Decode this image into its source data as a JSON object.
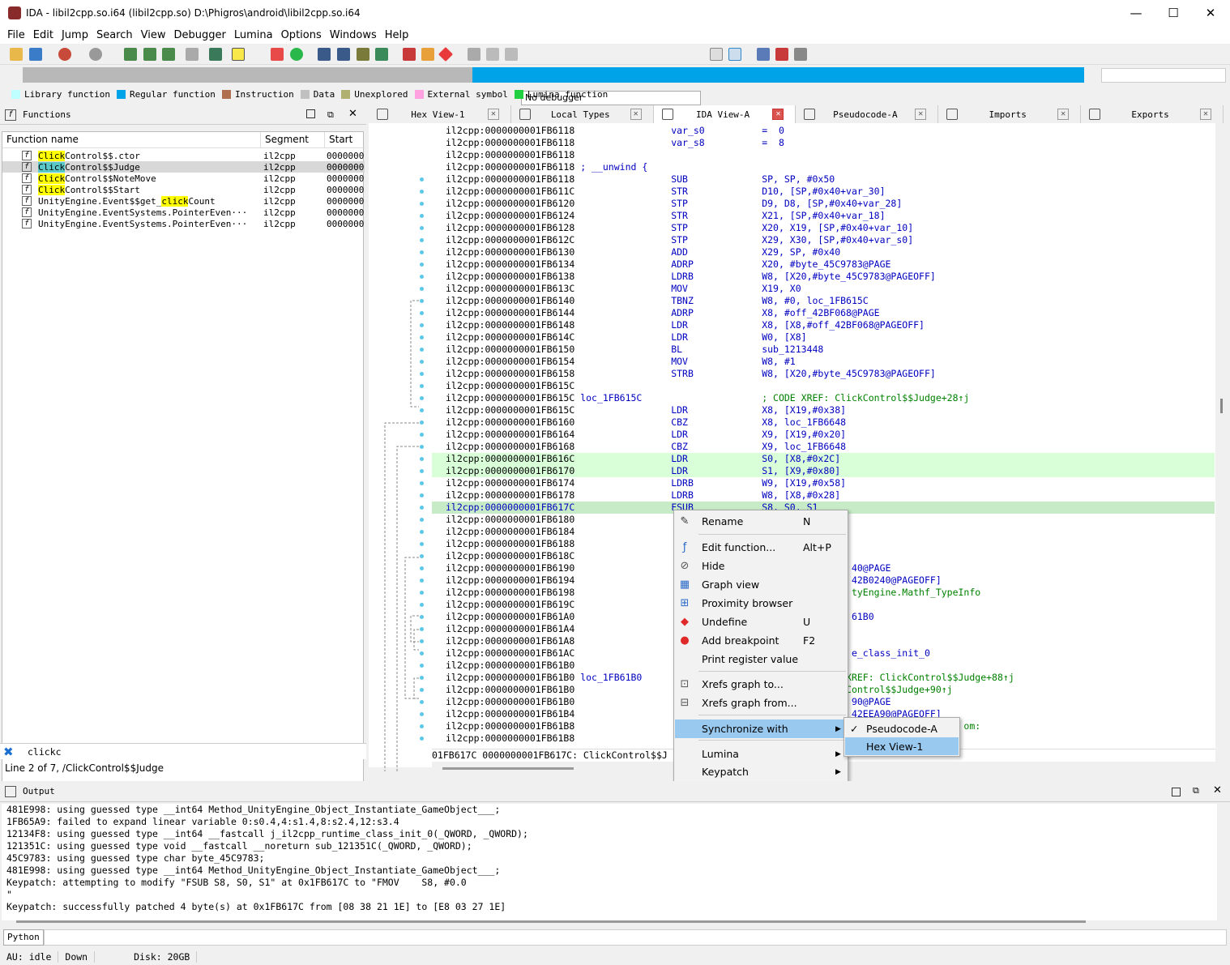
{
  "window": {
    "title": "IDA - libil2cpp.so.i64 (libil2cpp.so) D:\\Phigros\\android\\libil2cpp.so.i64",
    "minimize": "—",
    "maximize": "☐",
    "close": "✕"
  },
  "menu": [
    "File",
    "Edit",
    "Jump",
    "Search",
    "View",
    "Debugger",
    "Lumina",
    "Options",
    "Windows",
    "Help"
  ],
  "toolbar": {
    "debugger_select": "No debugger"
  },
  "legend": [
    {
      "label": "Library function",
      "color": "#c0ffff"
    },
    {
      "label": "Regular function",
      "color": "#00a2e8"
    },
    {
      "label": "Instruction",
      "color": "#b07050"
    },
    {
      "label": "Data",
      "color": "#c0c0c0"
    },
    {
      "label": "Unexplored",
      "color": "#b0b070"
    },
    {
      "label": "External symbol",
      "color": "#ffa0e0"
    },
    {
      "label": "Lumina function",
      "color": "#20d040"
    }
  ],
  "functions": {
    "title": "Functions",
    "columns": [
      "Function name",
      "Segment",
      "Start"
    ],
    "rows": [
      {
        "pre": "",
        "hl": "Click",
        "post": "Control$$.ctor",
        "seg": "il2cpp",
        "start": "0000000"
      },
      {
        "pre": "",
        "hl": "Click",
        "post": "Control$$Judge",
        "seg": "il2cpp",
        "start": "0000000"
      },
      {
        "pre": "",
        "hl": "Click",
        "post": "Control$$NoteMove",
        "seg": "il2cpp",
        "start": "0000000"
      },
      {
        "pre": "",
        "hl": "Click",
        "post": "Control$$Start",
        "seg": "il2cpp",
        "start": "0000000"
      },
      {
        "pre": "UnityEngine.Event$$get_",
        "hl": "click",
        "post": "Count",
        "seg": "il2cpp",
        "start": "0000000"
      },
      {
        "pre": "UnityEngine.EventSystems.PointerEven···",
        "hl": "",
        "post": "",
        "seg": "il2cpp",
        "start": "0000000"
      },
      {
        "pre": "UnityEngine.EventSystems.PointerEven···",
        "hl": "",
        "post": "",
        "seg": "il2cpp",
        "start": "0000000"
      }
    ],
    "filter": "clickc",
    "status": "Line 2 of 7, /ClickControl$$Judge"
  },
  "tabs": [
    {
      "label": "Hex View-1",
      "active": false
    },
    {
      "label": "Local Types",
      "active": false
    },
    {
      "label": "IDA View-A",
      "active": true
    },
    {
      "label": "Pseudocode-A",
      "active": false
    },
    {
      "label": "Imports",
      "active": false
    },
    {
      "label": "Exports",
      "active": false
    }
  ],
  "disasm": [
    {
      "addr": "il2cpp:0000000001FB6118",
      "l": "",
      "m": "var_s0",
      "o": "=  0",
      "c": ""
    },
    {
      "addr": "il2cpp:0000000001FB6118",
      "l": "",
      "m": "var_s8",
      "o": "=  8",
      "c": ""
    },
    {
      "addr": "il2cpp:0000000001FB6118",
      "l": "",
      "m": "",
      "o": "",
      "c": ""
    },
    {
      "addr": "il2cpp:0000000001FB6118",
      "l": "; __unwind {",
      "m": "",
      "o": "",
      "c": ""
    },
    {
      "addr": "il2cpp:0000000001FB6118",
      "l": "",
      "m": "SUB",
      "o": "SP, SP, #0x50",
      "c": ""
    },
    {
      "addr": "il2cpp:0000000001FB611C",
      "l": "",
      "m": "STR",
      "o": "D10, [SP,#0x40+var_30]",
      "c": ""
    },
    {
      "addr": "il2cpp:0000000001FB6120",
      "l": "",
      "m": "STP",
      "o": "D9, D8, [SP,#0x40+var_28]",
      "c": ""
    },
    {
      "addr": "il2cpp:0000000001FB6124",
      "l": "",
      "m": "STR",
      "o": "X21, [SP,#0x40+var_18]",
      "c": ""
    },
    {
      "addr": "il2cpp:0000000001FB6128",
      "l": "",
      "m": "STP",
      "o": "X20, X19, [SP,#0x40+var_10]",
      "c": ""
    },
    {
      "addr": "il2cpp:0000000001FB612C",
      "l": "",
      "m": "STP",
      "o": "X29, X30, [SP,#0x40+var_s0]",
      "c": ""
    },
    {
      "addr": "il2cpp:0000000001FB6130",
      "l": "",
      "m": "ADD",
      "o": "X29, SP, #0x40",
      "c": ""
    },
    {
      "addr": "il2cpp:0000000001FB6134",
      "l": "",
      "m": "ADRP",
      "o": "X20, #byte_45C9783@PAGE",
      "c": ""
    },
    {
      "addr": "il2cpp:0000000001FB6138",
      "l": "",
      "m": "LDRB",
      "o": "W8, [X20,#byte_45C9783@PAGEOFF]",
      "c": ""
    },
    {
      "addr": "il2cpp:0000000001FB613C",
      "l": "",
      "m": "MOV",
      "o": "X19, X0",
      "c": ""
    },
    {
      "addr": "il2cpp:0000000001FB6140",
      "l": "",
      "m": "TBNZ",
      "o": "W8, #0, loc_1FB615C",
      "c": ""
    },
    {
      "addr": "il2cpp:0000000001FB6144",
      "l": "",
      "m": "ADRP",
      "o": "X8, #off_42BF068@PAGE",
      "c": ""
    },
    {
      "addr": "il2cpp:0000000001FB6148",
      "l": "",
      "m": "LDR",
      "o": "X8, [X8,#off_42BF068@PAGEOFF]",
      "c": ""
    },
    {
      "addr": "il2cpp:0000000001FB614C",
      "l": "",
      "m": "LDR",
      "o": "W0, [X8]",
      "c": ""
    },
    {
      "addr": "il2cpp:0000000001FB6150",
      "l": "",
      "m": "BL",
      "o": "sub_1213448",
      "c": ""
    },
    {
      "addr": "il2cpp:0000000001FB6154",
      "l": "",
      "m": "MOV",
      "o": "W8, #1",
      "c": ""
    },
    {
      "addr": "il2cpp:0000000001FB6158",
      "l": "",
      "m": "STRB",
      "o": "W8, [X20,#byte_45C9783@PAGEOFF]",
      "c": ""
    },
    {
      "addr": "il2cpp:0000000001FB615C",
      "l": "",
      "m": "",
      "o": "",
      "c": ""
    },
    {
      "addr": "il2cpp:0000000001FB615C",
      "l": "loc_1FB615C",
      "m": "",
      "o": "",
      "c": "; CODE XREF: ClickControl$$Judge+28↑j"
    },
    {
      "addr": "il2cpp:0000000001FB615C",
      "l": "",
      "m": "LDR",
      "o": "X8, [X19,#0x38]",
      "c": ""
    },
    {
      "addr": "il2cpp:0000000001FB6160",
      "l": "",
      "m": "CBZ",
      "o": "X8, loc_1FB6648",
      "c": ""
    },
    {
      "addr": "il2cpp:0000000001FB6164",
      "l": "",
      "m": "LDR",
      "o": "X9, [X19,#0x20]",
      "c": ""
    },
    {
      "addr": "il2cpp:0000000001FB6168",
      "l": "",
      "m": "CBZ",
      "o": "X9, loc_1FB6648",
      "c": ""
    },
    {
      "addr": "il2cpp:0000000001FB616C",
      "l": "",
      "m": "LDR",
      "o": "S0, [X8,#0x2C]",
      "c": "",
      "hl": "grn"
    },
    {
      "addr": "il2cpp:0000000001FB6170",
      "l": "",
      "m": "LDR",
      "o": "S1, [X9,#0x80]",
      "c": "",
      "hl": "grn"
    },
    {
      "addr": "il2cpp:0000000001FB6174",
      "l": "",
      "m": "LDRB",
      "o": "W9, [X19,#0x58]",
      "c": ""
    },
    {
      "addr": "il2cpp:0000000001FB6178",
      "l": "",
      "m": "LDRB",
      "o": "W8, [X8,#0x28]",
      "c": ""
    },
    {
      "addr": "il2cpp:0000000001FB617C",
      "l": "",
      "m": "FSUB",
      "o": "S8, S0, S1",
      "c": "",
      "hl": "sel"
    },
    {
      "addr": "il2cpp:0000000001FB6180",
      "l": "",
      "m": "",
      "o": "",
      "c": ""
    },
    {
      "addr": "il2cpp:0000000001FB6184",
      "l": "",
      "m": "",
      "o": "",
      "c": ""
    },
    {
      "addr": "il2cpp:0000000001FB6188",
      "l": "",
      "m": "",
      "o": "",
      "c": ""
    },
    {
      "addr": "il2cpp:0000000001FB618C",
      "l": "",
      "m": "",
      "o": "",
      "c": ""
    },
    {
      "addr": "il2cpp:0000000001FB6190",
      "l": "",
      "m": "",
      "o": "                40@PAGE",
      "c": ""
    },
    {
      "addr": "il2cpp:0000000001FB6194",
      "l": "",
      "m": "",
      "o": "                42B0240@PAGEOFF]",
      "c": ""
    },
    {
      "addr": "il2cpp:0000000001FB6198",
      "l": "",
      "m": "",
      "o": "",
      "c": "                tyEngine.Mathf_TypeInfo"
    },
    {
      "addr": "il2cpp:0000000001FB619C",
      "l": "",
      "m": "",
      "o": "",
      "c": ""
    },
    {
      "addr": "il2cpp:0000000001FB61A0",
      "l": "",
      "m": "",
      "o": "                61B0",
      "c": ""
    },
    {
      "addr": "il2cpp:0000000001FB61A4",
      "l": "",
      "m": "",
      "o": "",
      "c": ""
    },
    {
      "addr": "il2cpp:0000000001FB61A8",
      "l": "",
      "m": "",
      "o": "",
      "c": ""
    },
    {
      "addr": "il2cpp:0000000001FB61AC",
      "l": "",
      "m": "",
      "o": "                e_class_init_0",
      "c": ""
    },
    {
      "addr": "il2cpp:0000000001FB61B0",
      "l": "",
      "m": "",
      "o": "",
      "c": ""
    },
    {
      "addr": "il2cpp:0000000001FB61B0",
      "l": "loc_1FB61B0",
      "m": "",
      "o": "",
      "c": "               XREF: ClickControl$$Judge+88↑j"
    },
    {
      "addr": "il2cpp:0000000001FB61B0",
      "l": "",
      "m": "",
      "o": "",
      "c": "               Control$$Judge+90↑j"
    },
    {
      "addr": "il2cpp:0000000001FB61B0",
      "l": "",
      "m": "",
      "o": "                90@PAGE",
      "c": ""
    },
    {
      "addr": "il2cpp:0000000001FB61B4",
      "l": "",
      "m": "",
      "o": "                42EEA90@PAGEOFF]",
      "c": ""
    },
    {
      "addr": "il2cpp:0000000001FB61B8",
      "l": "",
      "m": "",
      "o": "",
      "c": "                                    om:"
    },
    {
      "addr": "il2cpp:0000000001FB61B8",
      "l": "",
      "m": "",
      "o": "",
      "c": ""
    }
  ],
  "disasm_footer": "01FB617C 0000000001FB617C: ClickControl$$J",
  "context_menu": [
    {
      "icon": "rename-icon",
      "glyph": "✎",
      "label": "Rename",
      "shortcut": "N",
      "arrow": ""
    },
    {
      "icon": "edit-function-icon",
      "glyph": "ƒ",
      "label": "Edit function...",
      "shortcut": "Alt+P",
      "arrow": ""
    },
    {
      "icon": "hide-icon",
      "glyph": "⊘",
      "label": "Hide",
      "shortcut": "",
      "arrow": ""
    },
    {
      "icon": "graph-view-icon",
      "glyph": "▦",
      "label": "Graph view",
      "shortcut": "",
      "arrow": ""
    },
    {
      "icon": "proximity-browser-icon",
      "glyph": "⊞",
      "label": "Proximity browser",
      "shortcut": "",
      "arrow": ""
    },
    {
      "icon": "undefine-icon",
      "glyph": "◆",
      "label": "Undefine",
      "shortcut": "U",
      "arrow": ""
    },
    {
      "icon": "add-breakpoint-icon",
      "glyph": "●",
      "label": "Add breakpoint",
      "shortcut": "F2",
      "arrow": ""
    },
    {
      "icon": "",
      "glyph": "",
      "label": "Print register value",
      "shortcut": "",
      "arrow": ""
    },
    {
      "icon": "xrefs-to-icon",
      "glyph": "⊡",
      "label": "Xrefs graph to...",
      "shortcut": "",
      "arrow": ""
    },
    {
      "icon": "xrefs-from-icon",
      "glyph": "⊟",
      "label": "Xrefs graph from...",
      "shortcut": "",
      "arrow": ""
    },
    {
      "icon": "",
      "glyph": "",
      "label": "Synchronize with",
      "shortcut": "",
      "arrow": "▶"
    },
    {
      "icon": "",
      "glyph": "",
      "label": "Lumina",
      "shortcut": "",
      "arrow": "▶"
    },
    {
      "icon": "",
      "glyph": "",
      "label": "Keypatch",
      "shortcut": "",
      "arrow": "▶"
    },
    {
      "icon": "",
      "glyph": "",
      "label": "Font...",
      "shortcut": "",
      "arrow": ""
    }
  ],
  "submenu": [
    {
      "check": "✓",
      "label": "Pseudocode-A"
    },
    {
      "check": "",
      "label": "Hex View-1"
    }
  ],
  "output": {
    "title": "Output",
    "lines": [
      "481E998: using guessed type __int64 Method_UnityEngine_Object_Instantiate_GameObject___;",
      "1FB65A9: failed to expand linear variable 0:s0.4,4:s1.4,8:s2.4,12:s3.4",
      "12134F8: using guessed type __int64 __fastcall j_il2cpp_runtime_class_init_0(_QWORD, _QWORD);",
      "121351C: using guessed type void __fastcall __noreturn sub_121351C(_QWORD, _QWORD);",
      "45C9783: using guessed type char byte_45C9783;",
      "481E998: using guessed type __int64 Method_UnityEngine_Object_Instantiate_GameObject___;",
      "Keypatch: attempting to modify \"FSUB S8, S0, S1\" at 0x1FB617C to \"FMOV    S8, #0.0",
      "\"",
      "Keypatch: successfully patched 4 byte(s) at 0x1FB617C from [08 38 21 1E] to [E8 03 27 1E]"
    ]
  },
  "python_button": "Python",
  "status": {
    "au": "AU:  idle",
    "dir": "Down",
    "disk": "Disk: 20GB"
  }
}
